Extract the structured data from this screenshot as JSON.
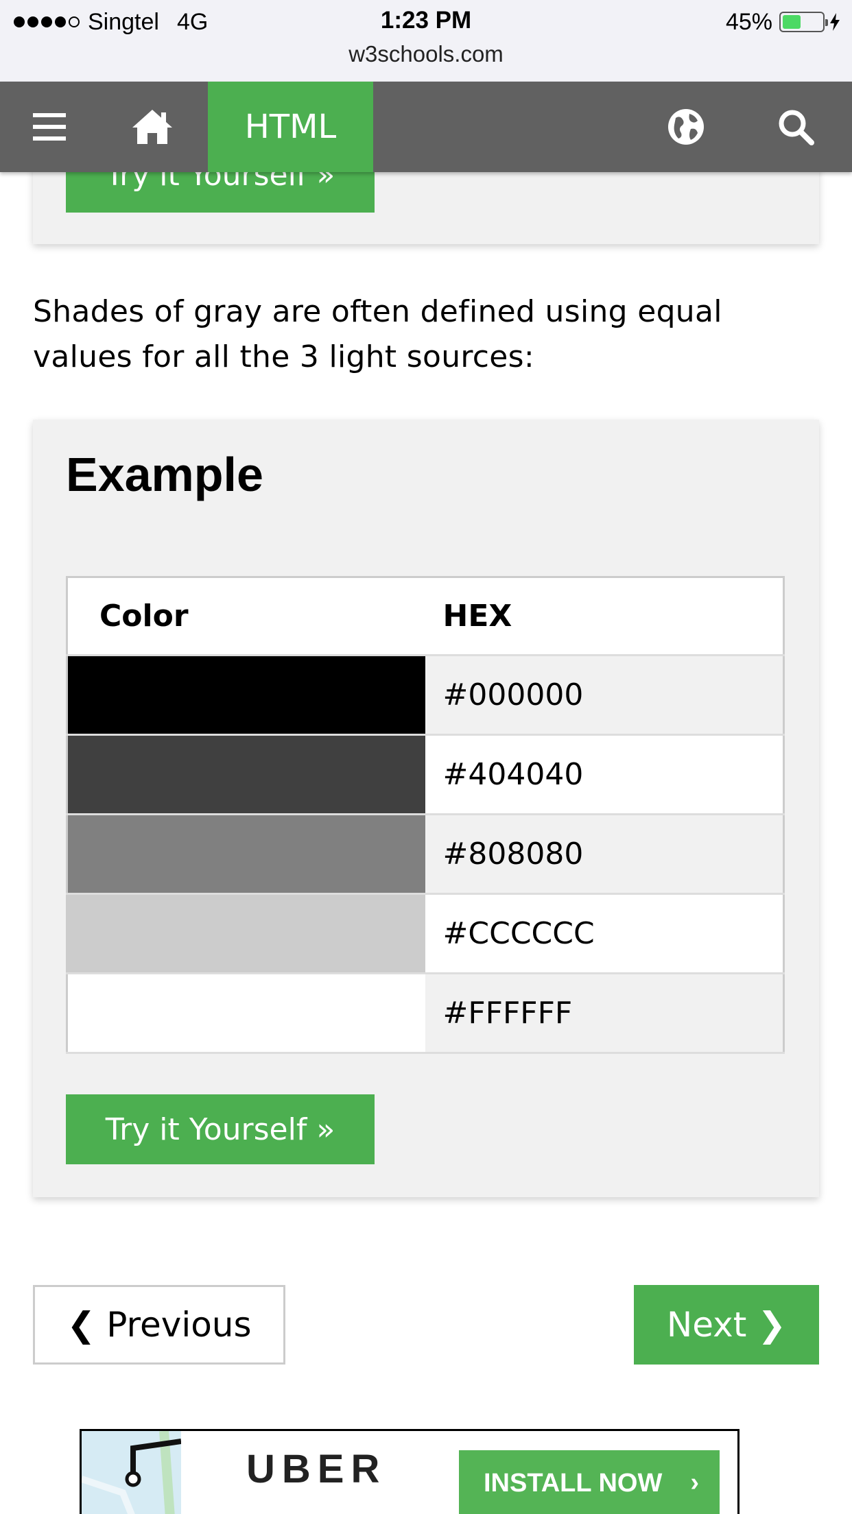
{
  "status_bar": {
    "carrier": "Singtel",
    "network": "4G",
    "time": "1:23 PM",
    "battery": "45%",
    "battery_level": 0.45,
    "url": "w3schools.com"
  },
  "navbar": {
    "active_item": "HTML",
    "icons": [
      "menu-icon",
      "home-icon",
      "globe-icon",
      "search-icon"
    ],
    "active_color": "#4caf50",
    "bg_color": "#616161"
  },
  "top_example": {
    "button_label": "Try it Yourself »"
  },
  "paragraph": "Shades of gray are often defined using equal values for all the 3 light sources:",
  "example": {
    "title": "Example",
    "headers": [
      "Color",
      "HEX"
    ],
    "rows": [
      {
        "color": "#000000",
        "hex": "#000000"
      },
      {
        "color": "#404040",
        "hex": "#404040"
      },
      {
        "color": "#808080",
        "hex": "#808080"
      },
      {
        "color": "#CCCCCC",
        "hex": "#CCCCCC"
      },
      {
        "color": "#FFFFFF",
        "hex": "#FFFFFF"
      }
    ],
    "button_label": "Try it Yourself »"
  },
  "pager": {
    "previous_label": "❮ Previous",
    "next_label": "Next ❯"
  },
  "ad": {
    "brand": "UBER",
    "cta": "INSTALL NOW",
    "cta_arrow": "›"
  }
}
